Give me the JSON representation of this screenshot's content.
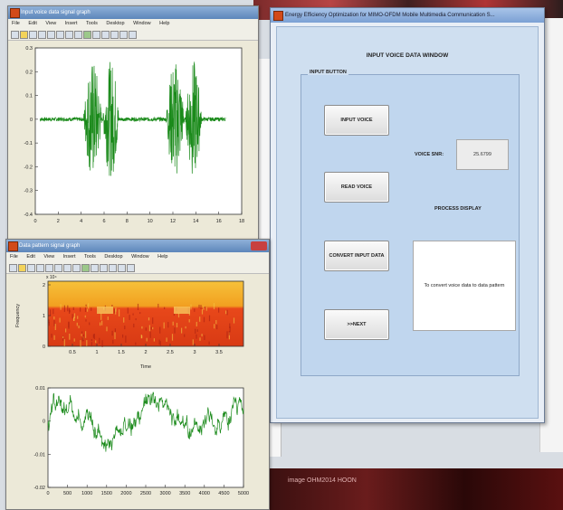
{
  "background": {
    "bottom_text": "image  OHM2014  HOON"
  },
  "figure1": {
    "title": "Input voice data signal graph",
    "menu": [
      "File",
      "Edit",
      "View",
      "Insert",
      "Tools",
      "Desktop",
      "Window",
      "Help"
    ],
    "y_ticks": [
      "0.3",
      "0.2",
      "0.1",
      "0",
      "-0.1",
      "-0.2",
      "-0.3",
      "-0.4"
    ],
    "x_ticks": [
      "0",
      "2",
      "4",
      "6",
      "8",
      "10",
      "12",
      "14",
      "16",
      "18"
    ]
  },
  "figure2": {
    "title": "Data pattern signal graph",
    "menu": [
      "File",
      "Edit",
      "View",
      "Insert",
      "Tools",
      "Desktop",
      "Window",
      "Help"
    ],
    "spec_y_exp": "x 10⁴",
    "spec_y_ticks": [
      "2",
      "1",
      "0"
    ],
    "spec_y_label": "Frequency",
    "spec_x_ticks": [
      "0.5",
      "1",
      "1.5",
      "2",
      "2.5",
      "3",
      "3.5"
    ],
    "spec_x_label": "Time",
    "wave_y_ticks": [
      "0.01",
      "0",
      "-0.01",
      "-0.02"
    ],
    "wave_x_ticks": [
      "0",
      "500",
      "1000",
      "1500",
      "2000",
      "2500",
      "3000",
      "3500",
      "4000",
      "4500",
      "5000"
    ]
  },
  "app": {
    "title": "Energy Efficiency Optimization for MIMO-OFDM Mobile Multimedia Communication S...",
    "header": "INPUT VOICE DATA WINDOW",
    "group_label": "INPUT BUTTON",
    "buttons": {
      "input_voice": "INPUT VOICE",
      "read_voice": "READ VOICE",
      "convert_input_data": "CONVERT INPUT DATA",
      "next": ">>NEXT"
    },
    "snr_label": "VOICE SNR:",
    "snr_value": "25.6799",
    "process_label": "PROCESS DISPLAY",
    "process_text": "To convert voice data to data pattern"
  },
  "colors": {
    "waveform": "#1a8a1a",
    "spectrogram_top": "#f4b428",
    "spectrogram_bottom": "#e04a1a",
    "titlebar": "#7ba0d4"
  }
}
